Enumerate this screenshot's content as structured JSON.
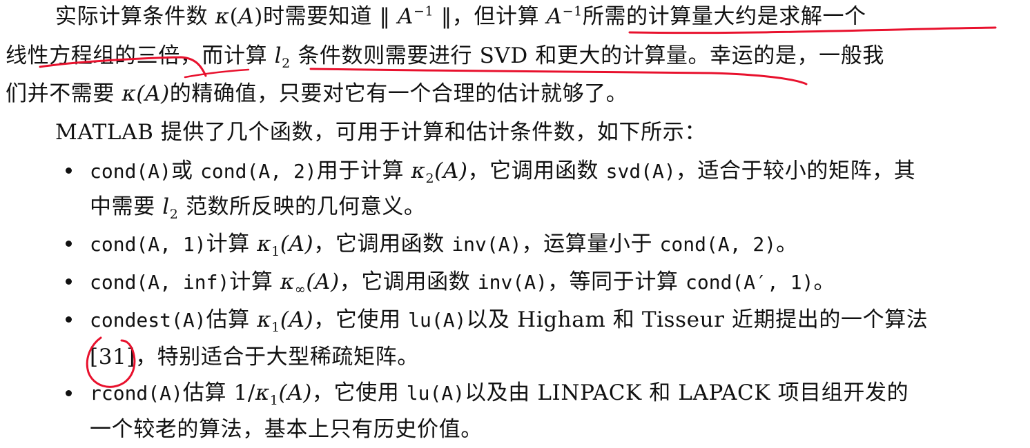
{
  "para1": {
    "line1": {
      "t1": "实际计算条件数 ",
      "kappa": "κ",
      "lp": "(",
      "A": "A",
      "rp": ")",
      "t2": "时需要知道 ‖ ",
      "inv_base": "A",
      "inv_exp": "−1",
      "t3": " ‖，但计算 ",
      "inv_base2": "A",
      "inv_exp2": "−1",
      "t4": "所需的计算量大约是求解一个"
    },
    "line2": {
      "t1": "线性方程组的三倍，而计算 ",
      "l": "l",
      "l_sub": "2",
      "t2": " 条件数则需要进行 SVD 和更大的计算量。幸运的是，一般我"
    },
    "line3": {
      "t1": "们并不需要 ",
      "kappa": "κ",
      "arg": "(A)",
      "t2": "的精确值，只要对它有一个合理的估计就够了。"
    }
  },
  "para2": {
    "intro": "MATLAB 提供了几个函数，可用于计算和估计条件数，如下所示："
  },
  "bullets": [
    {
      "a": "cond(A)",
      "b": "或 ",
      "c": "cond(A, 2)",
      "d": "用于计算 ",
      "k": "κ",
      "ksub": "2",
      "arg": "(A)",
      "e": "，它调用函数 ",
      "f": "svd(A)",
      "g": "，适合于较小的矩阵，其",
      "line2_a": "中需要 ",
      "line2_l": "l",
      "line2_lsub": "2",
      "line2_b": " 范数所反映的几何意义。"
    },
    {
      "a": "cond(A, 1)",
      "b": "计算 ",
      "k": "κ",
      "ksub": "1",
      "arg": "(A)",
      "c": "，它调用函数 ",
      "d": "inv(A)",
      "e": "，运算量小于 ",
      "f": "cond(A, 2)",
      "g": "。"
    },
    {
      "a": "cond(A, inf)",
      "b": "计算 ",
      "k": "κ",
      "ksub": "∞",
      "arg": "(A)",
      "c": "，它调用函数 ",
      "d": "inv(A)",
      "e": "，等同于计算 ",
      "f": "cond(A′, 1)",
      "g": "。"
    },
    {
      "a": "condest(A)",
      "b": "估算 ",
      "k": "κ",
      "ksub": "1",
      "arg": "(A)",
      "c": "，它使用 ",
      "d": "lu(A)",
      "e": "以及 Higham 和 Tisseur 近期提出的一个算法",
      "line2": "[31]，特别适合于大型稀疏矩阵。"
    },
    {
      "a": "rcond(A)",
      "b": "估算 1/",
      "k": "κ",
      "ksub": "1",
      "arg": "(A)",
      "c": "，它使用 ",
      "d": "lu(A)",
      "e": "以及由 LINPACK 和 LAPACK 项目组开发的",
      "line2": "一个较老的算法，基本上只有历史价值。"
    }
  ],
  "colors": {
    "text": "#111111",
    "annotation": "#e8112d"
  }
}
